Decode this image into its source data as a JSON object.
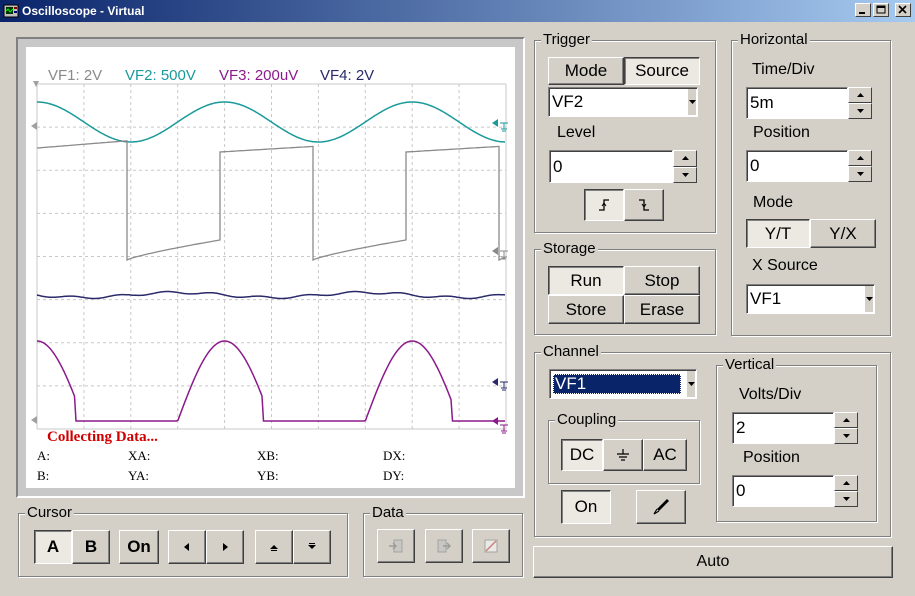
{
  "window": {
    "title": "Oscilloscope - Virtual"
  },
  "screen": {
    "channels": [
      {
        "label": "VF1: 2V",
        "color": "#8a8a8a"
      },
      {
        "label": "VF2: 500V",
        "color": "#1a9a9a"
      },
      {
        "label": "VF3: 200uV",
        "color": "#8b1a8b"
      },
      {
        "label": "VF4: 2V",
        "color": "#2a2a6a"
      }
    ],
    "status": "Collecting Data...",
    "readouts": {
      "a": "A:",
      "b": "B:",
      "xa": "XA:",
      "ya": "YA:",
      "xb": "XB:",
      "yb": "YB:",
      "dx": "DX:",
      "dy": "DY:"
    }
  },
  "trigger": {
    "title": "Trigger",
    "mode_label": "Mode",
    "source_label": "Source",
    "source_value": "VF2",
    "level_label": "Level",
    "level_value": "0"
  },
  "horizontal": {
    "title": "Horizontal",
    "timediv_label": "Time/Div",
    "timediv_value": "5m",
    "position_label": "Position",
    "position_value": "0",
    "mode_label": "Mode",
    "yt_label": "Y/T",
    "yx_label": "Y/X",
    "xsource_label": "X Source",
    "xsource_value": "VF1"
  },
  "storage": {
    "title": "Storage",
    "run_label": "Run",
    "stop_label": "Stop",
    "store_label": "Store",
    "erase_label": "Erase"
  },
  "channel": {
    "title": "Channel",
    "selected": "VF1",
    "coupling_title": "Coupling",
    "dc_label": "DC",
    "ac_label": "AC",
    "on_label": "On"
  },
  "vertical": {
    "title": "Vertical",
    "voltsdiv_label": "Volts/Div",
    "voltsdiv_value": "2",
    "position_label": "Position",
    "position_value": "0"
  },
  "cursor": {
    "title": "Cursor",
    "a_label": "A",
    "b_label": "B",
    "on_label": "On"
  },
  "data": {
    "title": "Data"
  },
  "auto_label": "Auto"
}
